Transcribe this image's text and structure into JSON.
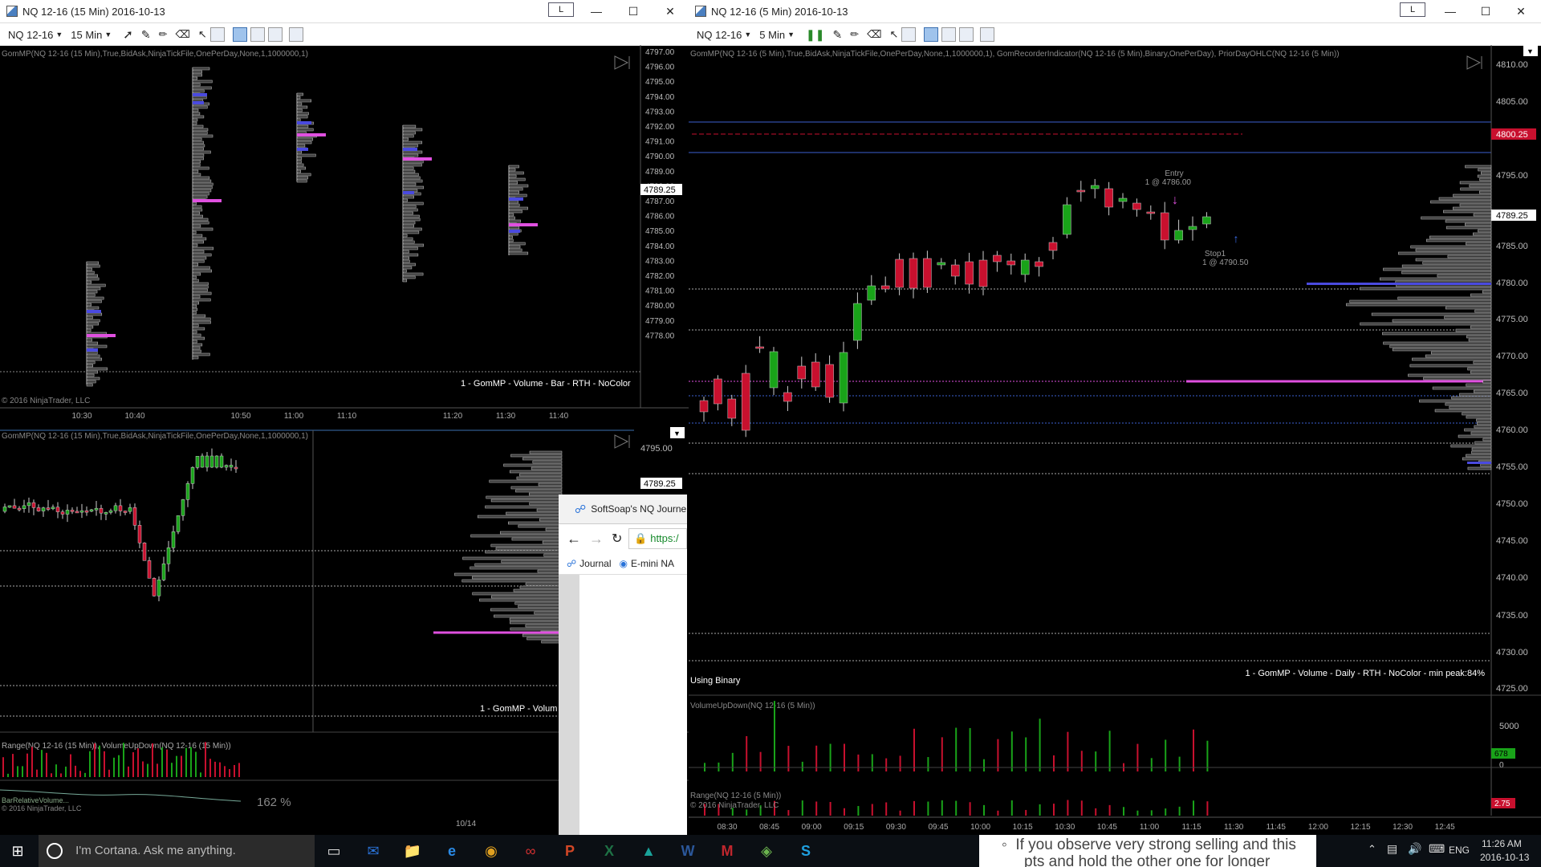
{
  "left_top_window": {
    "title": "NQ 12-16 (15 Min)  2016-10-13",
    "l_label": "L",
    "toolbar": {
      "instrument": "NQ 12-16",
      "interval": "15 Min"
    },
    "indicator_label": "GomMP(NQ 12-16 (15 Min),True,BidAsk,NinjaTickFile,OnePerDay,None,1,1000000,1)",
    "profile_label": "1 - GomMP  - Volume - Bar - RTH - NoColor",
    "copyright": "© 2016 NinjaTrader, LLC",
    "price_ticks": [
      "4797.00",
      "4796.00",
      "4795.00",
      "4794.00",
      "4793.00",
      "4792.00",
      "4791.00",
      "4790.00",
      "4789.00",
      "4788.00",
      "4787.00",
      "4786.00",
      "4785.00",
      "4784.00",
      "4783.00",
      "4782.00",
      "4781.00",
      "4780.00",
      "4779.00",
      "4778.00"
    ],
    "current_price": "4789.25",
    "time_ticks": [
      "10:30",
      "10:40",
      "10:50",
      "11:00",
      "11:10",
      "11:20",
      "11:30",
      "11:40"
    ]
  },
  "left_bottom_window": {
    "indicator_label": "GomMP(NQ 12-16 (15 Min),True,BidAsk,NinjaTickFile,OnePerDay,None,1,1000000,1)",
    "price_ticks": [
      "4795.00"
    ],
    "current_price": "4789.25",
    "profile_label": "1 - GomMP  - Volum",
    "sub_label": "Range(NQ 12-16 (15 Min)), VolumeUpDown(NQ 12-16 (15 Min))",
    "rel_vol_label": "BarRelativeVolume...",
    "rel_vol_value": "162 %",
    "copyright": "© 2016 NinjaTrader, LLC",
    "date_tick": "10/14"
  },
  "browser": {
    "tab_title": "SoftSoap's NQ Journe",
    "url": "https:/",
    "bookmarks": [
      "Journal",
      "E-mini NA"
    ]
  },
  "right_window": {
    "title": "NQ 12-16 (5 Min)  2016-10-13",
    "l_label": "L",
    "toolbar": {
      "instrument": "NQ 12-16",
      "interval": "5 Min"
    },
    "indicator_label": "GomMP(NQ 12-16 (5 Min),True,BidAsk,NinjaTickFile,OnePerDay,None,1,1000000,1), GomRecorderIndicator(NQ 12-16 (5 Min),Binary,OnePerDay), PriorDayOHLC(NQ 12-16 (5 Min))",
    "price_ticks": [
      "4810.00",
      "4805.00",
      "4800.25",
      "4795.00",
      "4789.25",
      "4785.00",
      "4780.00",
      "4775.00",
      "4770.00",
      "4765.00",
      "4760.00",
      "4755.00",
      "4750.00",
      "4745.00",
      "4740.00",
      "4735.00",
      "4730.00",
      "4725.00"
    ],
    "prior_high_price": "4800.25",
    "current_price": "4789.25",
    "entry_label": "Entry",
    "entry_detail": "1 @ 4786.00",
    "stop_label": "Stop1",
    "stop_detail": "1 @ 4790.50",
    "using_binary": "Using Binary",
    "profile_label": "1 - GomMP  - Volume - Daily - RTH - NoColor - min peak:84%",
    "vol_label": "VolumeUpDown(NQ 12-16 (5 Min))",
    "vol_tick": "5000",
    "vol_value": "678",
    "vol_zero": "0",
    "range_label": "Range(NQ 12-16 (5 Min))",
    "range_value": "2.75",
    "copyright": "© 2016 NinjaTrader, LLC",
    "time_ticks": [
      "08:30",
      "08:45",
      "09:00",
      "09:15",
      "09:30",
      "09:45",
      "10:00",
      "10:15",
      "10:30",
      "10:45",
      "11:00",
      "11:15",
      "11:30",
      "11:45",
      "12:00",
      "12:15",
      "12:30",
      "12:45"
    ]
  },
  "taskbar": {
    "cortana_placeholder": "I'm Cortana. Ask me anything.",
    "notes_line1": "If you observe very strong selling and this",
    "notes_line2": "pts and hold the other one for longer",
    "lang": "ENG",
    "time": "11:26 AM",
    "date": "2016-10-13"
  },
  "colors": {
    "up": "#19a319",
    "down": "#c8102e",
    "poc": "#e050e0",
    "value_area": "#4a4adf",
    "prior_high": "#c8102e"
  }
}
